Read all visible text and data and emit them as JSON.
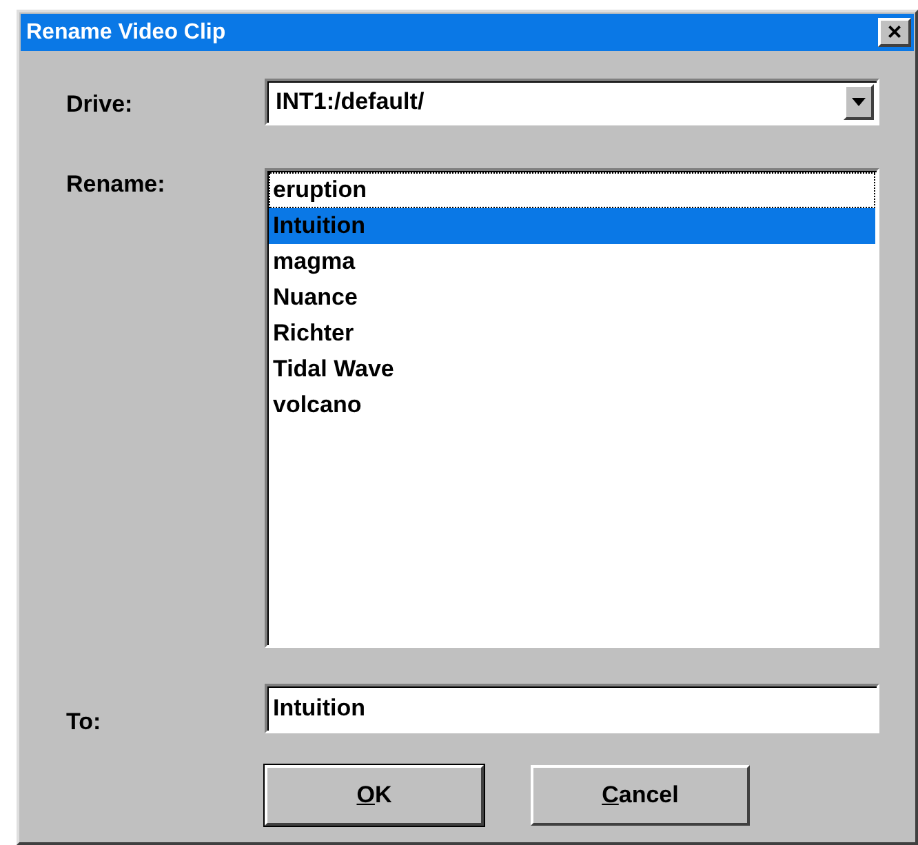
{
  "window": {
    "title": "Rename Video Clip",
    "close": "×"
  },
  "drive": {
    "label": "Drive:",
    "value": "INT1:/default/"
  },
  "rename": {
    "label": "Rename:",
    "items": [
      {
        "text": "eruption",
        "selected": false,
        "focused": true
      },
      {
        "text": "Intuition",
        "selected": true,
        "focused": false
      },
      {
        "text": "magma",
        "selected": false,
        "focused": false
      },
      {
        "text": "Nuance",
        "selected": false,
        "focused": false
      },
      {
        "text": "Richter",
        "selected": false,
        "focused": false
      },
      {
        "text": "Tidal Wave",
        "selected": false,
        "focused": false
      },
      {
        "text": "volcano",
        "selected": false,
        "focused": false
      }
    ]
  },
  "to": {
    "label": "To:",
    "value": "Intuition"
  },
  "buttons": [
    {
      "label": "OK",
      "default": true,
      "mnemonic_first": true
    },
    {
      "label": "Cancel",
      "default": false,
      "mnemonic_first": true
    }
  ]
}
